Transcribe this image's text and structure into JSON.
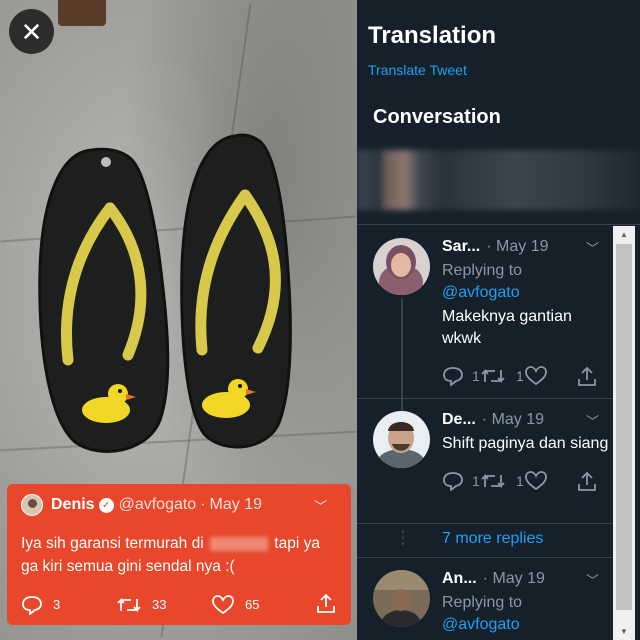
{
  "viewer": {
    "close_icon": "close-icon",
    "close_glyph": "✕"
  },
  "quoted_tweet": {
    "name": "Denis",
    "handle": "@avfogato",
    "dot": "·",
    "date": "May 19",
    "text_before": "Iya sih garansi termurah di",
    "text_after": "tapi ya ga kiri semua gini sendal nya :(",
    "replies": "3",
    "retweets": "33",
    "likes": "65",
    "color": "#e8472b"
  },
  "sidebar": {
    "translation_title": "Translation",
    "translate_link": "Translate Tweet",
    "conversation_title": "Conversation",
    "replies": [
      {
        "name": "Sar...",
        "meta": "· May 19",
        "replying_prefix": "Replying to",
        "replying_handle": "@avfogato",
        "text": "Makeknya gantian wkwk",
        "retweets": "1",
        "likes": "1"
      },
      {
        "name": "De...",
        "meta": "· May 19",
        "text": "Shift paginya dan siang",
        "retweets": "1",
        "likes": "1"
      },
      {
        "name": "An...",
        "meta": "· May 19",
        "replying_prefix": "Replying to",
        "replying_handle": "@avfogato"
      }
    ],
    "more_replies": "7 more replies"
  },
  "colors": {
    "link": "#1da1f2",
    "side_bg": "#15202b",
    "muted": "#8899a6"
  }
}
